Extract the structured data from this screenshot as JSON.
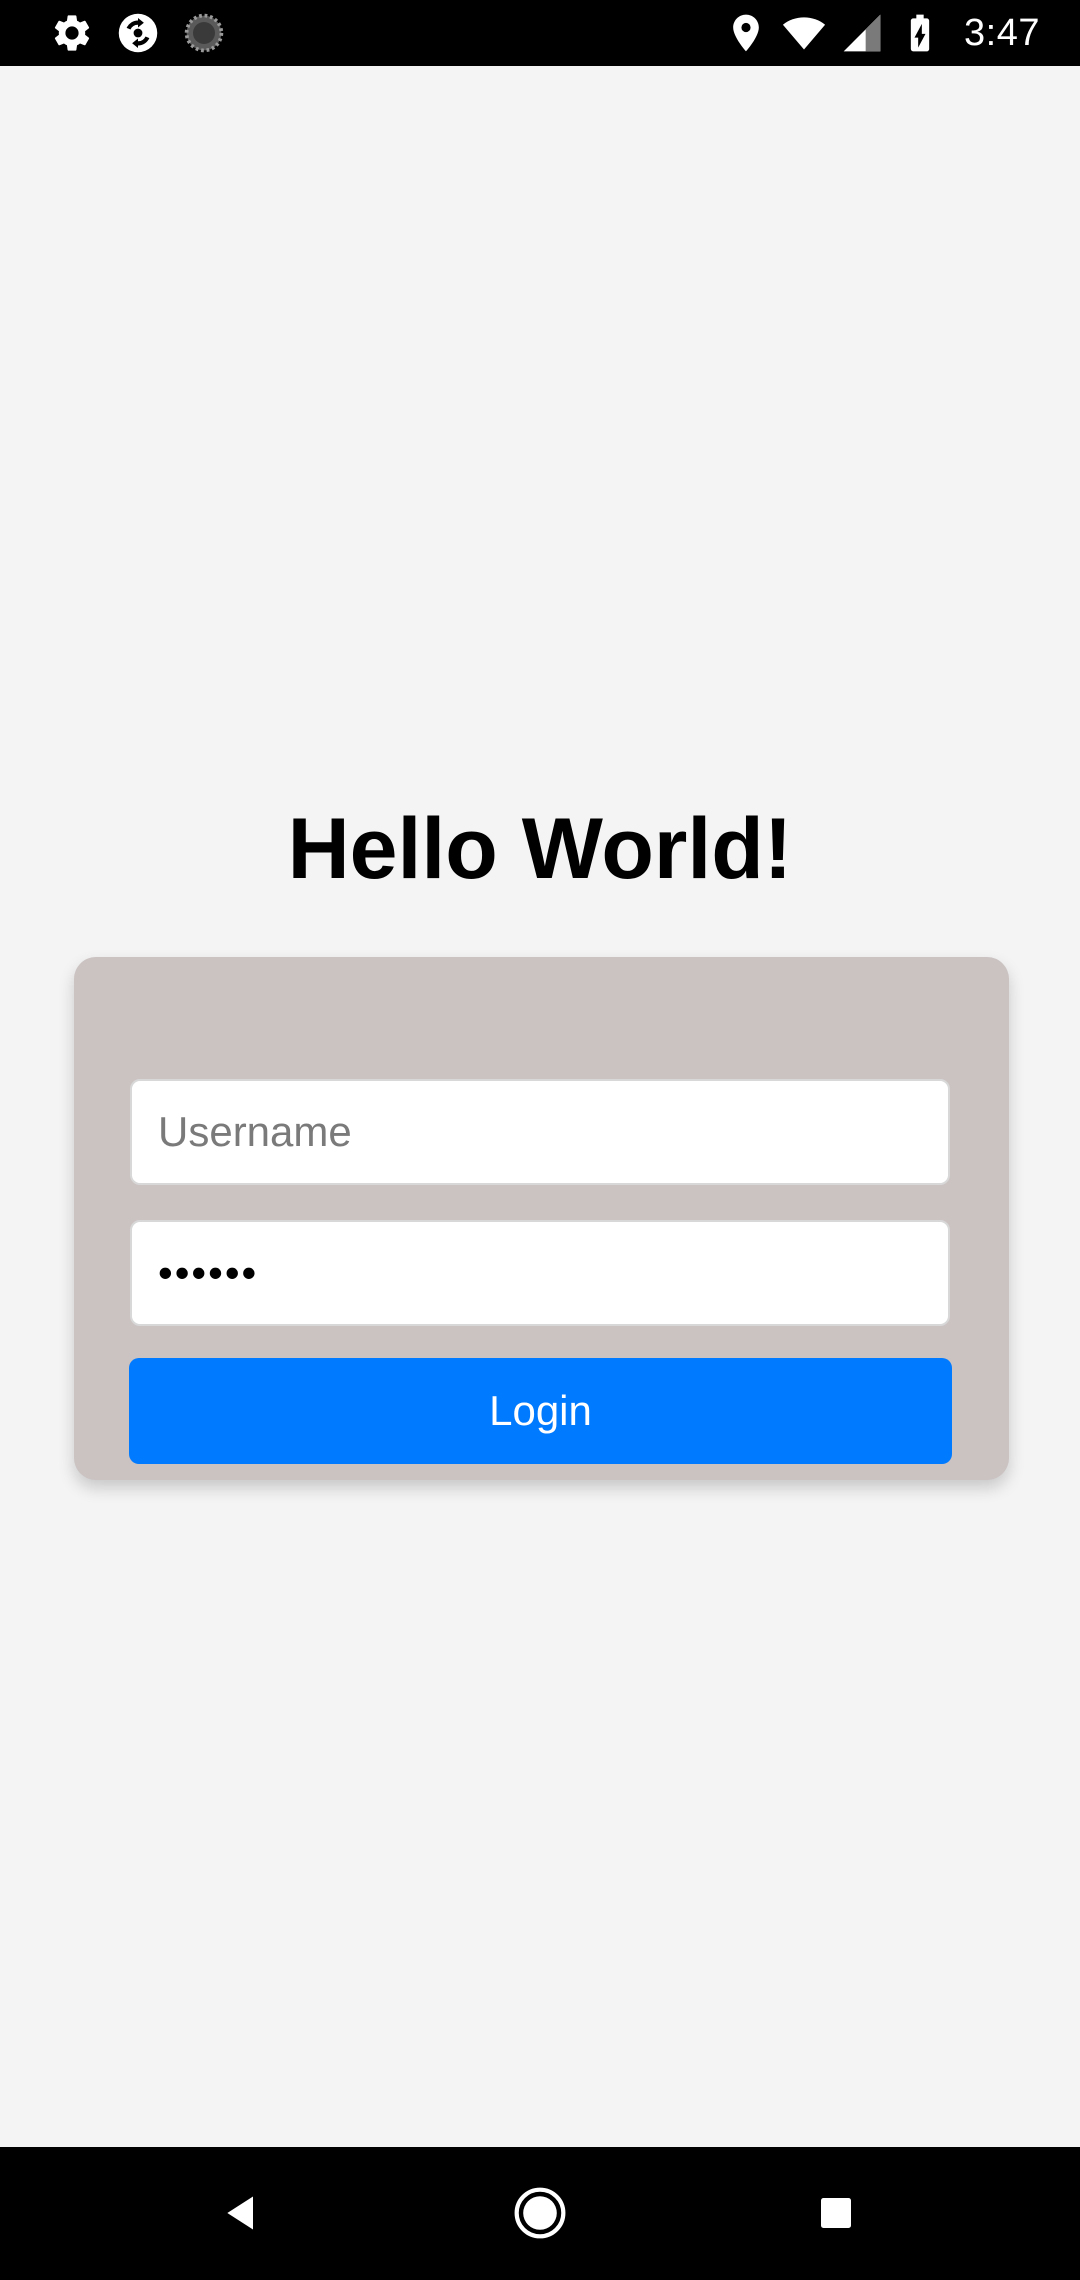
{
  "status_bar": {
    "time": "3:47",
    "left_icons": [
      "gear-icon",
      "sync-app-icon",
      "loading-spinner-icon"
    ],
    "right_icons": [
      "location-pin-icon",
      "wifi-icon",
      "cell-signal-icon",
      "battery-charging-icon"
    ]
  },
  "main": {
    "title": "Hello World!"
  },
  "login_form": {
    "username_placeholder": "Username",
    "username_value": "",
    "password_value": "••••••",
    "login_label": "Login"
  },
  "colors": {
    "background": "#f4f4f4",
    "card": "#cbc2c2",
    "button": "#007aff",
    "bars": "#000000"
  },
  "nav_bar": {
    "buttons": [
      "back-icon",
      "home-icon",
      "recents-icon"
    ]
  }
}
